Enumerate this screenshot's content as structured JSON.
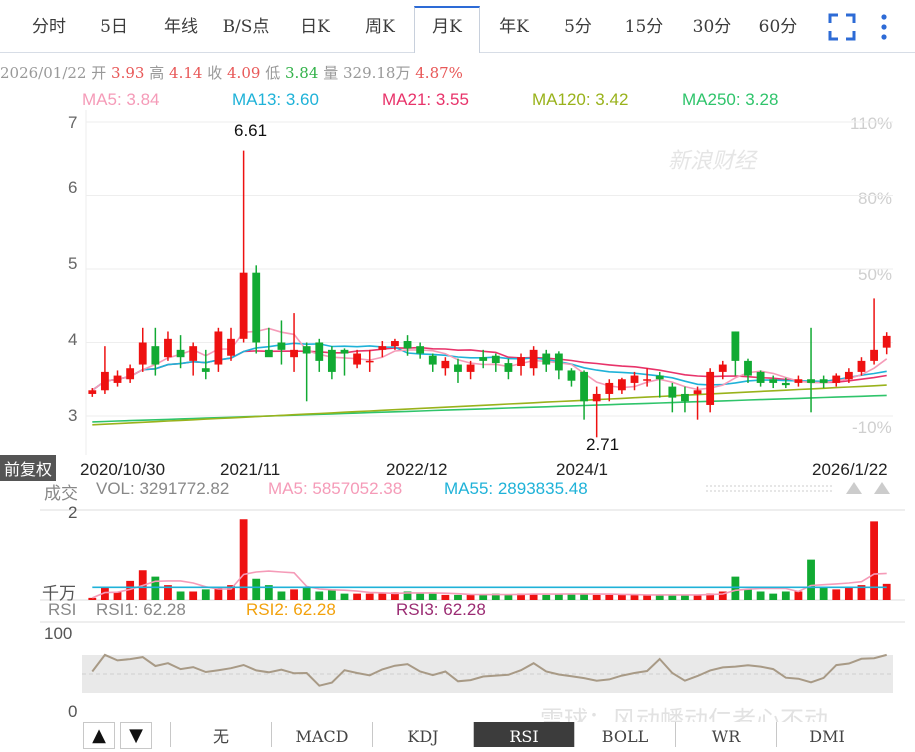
{
  "tabs": [
    "分时",
    "5日",
    "年线",
    "B/S点",
    "日K",
    "周K",
    "月K",
    "年K",
    "5分",
    "15分",
    "30分",
    "60分"
  ],
  "active_tab": "月K",
  "info": {
    "date": "2026/01/22",
    "open_label": "开",
    "open": "3.93",
    "high_label": "高",
    "high": "4.14",
    "close_label": "收",
    "close": "4.09",
    "low_label": "低",
    "low": "3.84",
    "vol_label": "量",
    "vol": "329.18万",
    "change": "4.87%"
  },
  "ma_legend": [
    {
      "text": "MA5: 3.84",
      "color": "#f59bb8"
    },
    {
      "text": "MA13: 3.60",
      "color": "#1fb2d8"
    },
    {
      "text": "MA21: 3.55",
      "color": "#e8336a"
    },
    {
      "text": "MA120: 3.42",
      "color": "#99b21b"
    },
    {
      "text": "MA250: 3.28",
      "color": "#2fc46b"
    }
  ],
  "watermark_top": "新浪财经",
  "price_axis": {
    "ticks": [
      "7",
      "6",
      "5",
      "4",
      "3"
    ],
    "pct_ticks": [
      "110%",
      "80%",
      "50%",
      "-10%"
    ]
  },
  "price_annotations": {
    "high": "6.61",
    "low": "2.71"
  },
  "adjust_badge": "前复权",
  "date_labels": [
    "2020/10/30",
    "2021/11",
    "2022/12",
    "2024/1",
    "2026/1/22"
  ],
  "volume": {
    "label": "成交",
    "vol_text": "VOL: 3291772.82",
    "ma5_text": "MA5: 5857052.38",
    "ma55_text": "MA55: 2893835.48",
    "ticks": [
      "2",
      "千万"
    ]
  },
  "rsi": {
    "label": "RSI",
    "rsi1": "RSI1: 62.28",
    "rsi2": "RSI2: 62.28",
    "rsi3": "RSI3: 62.28",
    "ticks": [
      "100",
      "0"
    ]
  },
  "bottom_tabs": [
    "无",
    "MACD",
    "KDJ",
    "RSI",
    "BOLL",
    "WR",
    "DMI"
  ],
  "active_bottom_tab": "RSI",
  "watermark_bottom": "雪球：风动幡动仁者心不动",
  "colors": {
    "up": "#ee1111",
    "down": "#11aa33",
    "active_tab": "#2d6bd6"
  },
  "chart_data": {
    "type": "candlestick",
    "period": "monthly",
    "x": [
      "2020/10",
      "2020/11",
      "2020/12",
      "2021/01",
      "2021/02",
      "2021/03",
      "2021/04",
      "2021/05",
      "2021/06",
      "2021/07",
      "2021/08",
      "2021/09",
      "2021/10",
      "2021/11",
      "2021/12",
      "2022/01",
      "2022/02",
      "2022/03",
      "2022/04",
      "2022/05",
      "2022/06",
      "2022/07",
      "2022/08",
      "2022/09",
      "2022/10",
      "2022/11",
      "2022/12",
      "2023/01",
      "2023/02",
      "2023/03",
      "2023/04",
      "2023/05",
      "2023/06",
      "2023/07",
      "2023/08",
      "2023/09",
      "2023/10",
      "2023/11",
      "2023/12",
      "2024/01",
      "2024/02",
      "2024/03",
      "2024/04",
      "2024/05",
      "2024/06",
      "2024/07",
      "2024/08",
      "2024/09",
      "2024/10",
      "2024/11",
      "2024/12",
      "2025/01",
      "2025/02",
      "2025/03",
      "2025/04",
      "2025/05",
      "2025/06",
      "2025/07",
      "2025/08",
      "2025/09",
      "2025/10",
      "2025/11",
      "2025/12",
      "2026/01"
    ],
    "open": [
      3.3,
      3.35,
      3.45,
      3.5,
      3.7,
      3.95,
      3.8,
      3.9,
      3.75,
      3.65,
      3.7,
      3.82,
      4.05,
      4.95,
      3.9,
      4.0,
      3.8,
      3.95,
      4.0,
      3.9,
      3.9,
      3.7,
      3.75,
      3.9,
      3.95,
      4.02,
      3.95,
      3.82,
      3.65,
      3.7,
      3.6,
      3.8,
      3.82,
      3.72,
      3.68,
      3.65,
      3.85,
      3.85,
      3.62,
      3.6,
      3.2,
      3.3,
      3.35,
      3.45,
      3.5,
      3.55,
      3.4,
      3.3,
      3.3,
      3.15,
      3.6,
      4.15,
      3.75,
      3.6,
      3.5,
      3.45,
      3.45,
      3.5,
      3.5,
      3.45,
      3.5,
      3.6,
      3.75,
      3.93
    ],
    "close": [
      3.35,
      3.6,
      3.55,
      3.65,
      4.0,
      3.7,
      4.05,
      3.8,
      3.95,
      3.6,
      4.15,
      4.05,
      4.95,
      4.0,
      3.8,
      3.9,
      3.9,
      3.85,
      3.75,
      3.6,
      3.85,
      3.85,
      3.75,
      3.95,
      4.02,
      3.92,
      3.85,
      3.7,
      3.75,
      3.6,
      3.7,
      3.75,
      3.72,
      3.6,
      3.8,
      3.9,
      3.7,
      3.62,
      3.48,
      3.2,
      3.3,
      3.45,
      3.5,
      3.55,
      3.5,
      3.5,
      3.25,
      3.2,
      3.35,
      3.6,
      3.7,
      3.75,
      3.55,
      3.45,
      3.45,
      3.42,
      3.5,
      3.45,
      3.45,
      3.55,
      3.6,
      3.75,
      3.9,
      4.09
    ],
    "high": [
      3.38,
      3.95,
      3.62,
      3.7,
      4.2,
      4.2,
      4.15,
      4.1,
      4.0,
      3.9,
      4.2,
      4.2,
      6.61,
      5.05,
      4.2,
      4.3,
      4.4,
      4.0,
      4.05,
      3.95,
      3.92,
      3.9,
      3.9,
      4.02,
      4.05,
      4.1,
      4.0,
      3.85,
      3.8,
      3.78,
      3.75,
      3.9,
      3.85,
      3.78,
      3.85,
      3.95,
      3.9,
      3.88,
      3.65,
      3.62,
      3.4,
      3.5,
      3.52,
      3.6,
      3.65,
      3.6,
      3.45,
      3.4,
      3.4,
      3.65,
      3.75,
      4.15,
      3.78,
      3.62,
      3.55,
      3.52,
      3.55,
      4.2,
      3.55,
      3.58,
      3.65,
      3.8,
      4.6,
      4.14
    ],
    "low": [
      3.26,
      3.3,
      3.4,
      3.45,
      3.6,
      3.55,
      3.75,
      3.65,
      3.55,
      3.5,
      3.6,
      3.75,
      4.0,
      3.85,
      3.85,
      3.7,
      3.6,
      3.2,
      3.6,
      3.5,
      3.55,
      3.65,
      3.6,
      3.8,
      3.9,
      3.82,
      3.78,
      3.6,
      3.55,
      3.45,
      3.5,
      3.65,
      3.6,
      3.5,
      3.55,
      3.55,
      3.6,
      3.5,
      3.4,
      2.95,
      2.71,
      3.2,
      3.3,
      3.35,
      3.4,
      3.25,
      3.05,
      3.05,
      2.95,
      3.05,
      3.5,
      3.55,
      3.45,
      3.4,
      3.38,
      3.38,
      3.4,
      3.05,
      3.38,
      3.4,
      3.45,
      3.55,
      3.7,
      3.84
    ],
    "volume_ten_million": [
      0.05,
      0.3,
      0.2,
      0.45,
      0.7,
      0.55,
      0.35,
      0.2,
      0.2,
      0.25,
      0.3,
      0.35,
      1.9,
      0.5,
      0.35,
      0.2,
      0.25,
      0.3,
      0.2,
      0.25,
      0.15,
      0.15,
      0.15,
      0.15,
      0.18,
      0.2,
      0.15,
      0.15,
      0.12,
      0.12,
      0.12,
      0.12,
      0.15,
      0.12,
      0.15,
      0.15,
      0.12,
      0.15,
      0.15,
      0.15,
      0.12,
      0.12,
      0.12,
      0.12,
      0.12,
      0.12,
      0.12,
      0.12,
      0.12,
      0.15,
      0.2,
      0.55,
      0.25,
      0.2,
      0.15,
      0.2,
      0.2,
      0.95,
      0.3,
      0.25,
      0.3,
      0.35,
      1.85,
      0.38
    ],
    "rsi_range": [
      0,
      100
    ],
    "price_range": [
      2.3,
      7.1
    ],
    "dates_shown": [
      "2020/10/30",
      "2021/11",
      "2022/12",
      "2024/1",
      "2026/1/22"
    ]
  }
}
